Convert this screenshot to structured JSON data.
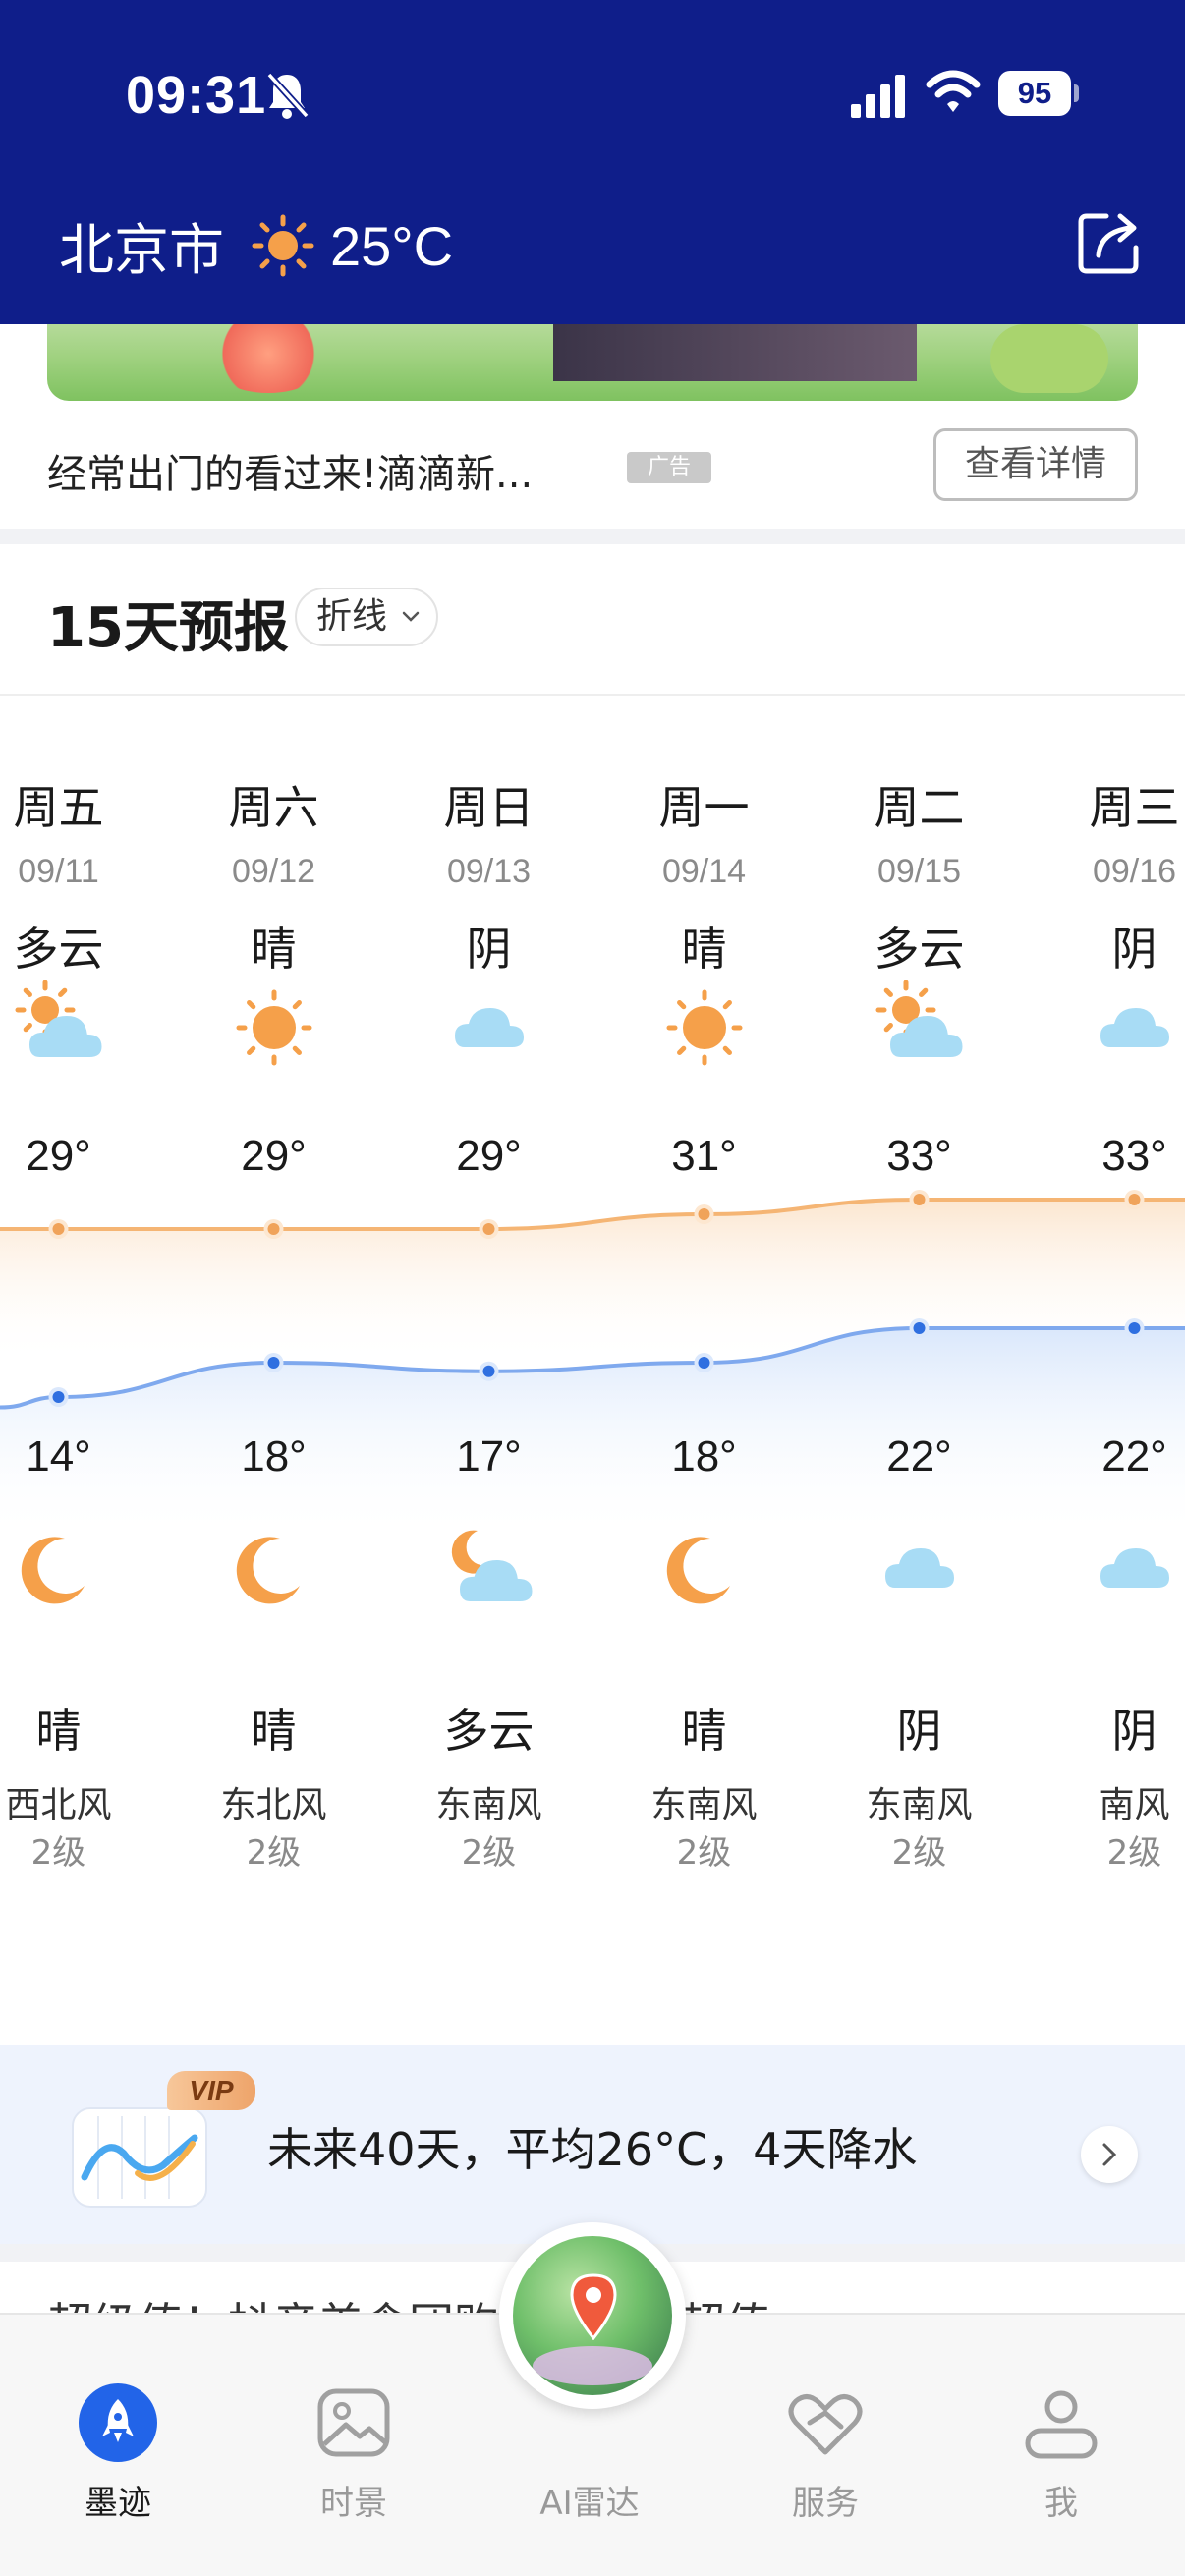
{
  "status_bar": {
    "time": "09:31",
    "battery": "95"
  },
  "header": {
    "city": "北京市",
    "temperature": "25°C"
  },
  "ad": {
    "text": "经常出门的看过来!滴滴新...",
    "badge": "广告",
    "detail_button": "查看详情"
  },
  "forecast": {
    "title": "15天预报",
    "toggle_label": "折线",
    "days": [
      {
        "name": "周五",
        "date": "09/11",
        "day_cond": "多云",
        "day_icon": "partly-cloudy-icon",
        "high": "29°",
        "low": "14°",
        "night_icon": "moon-icon",
        "night_cond": "晴",
        "wind_dir": "西北风",
        "wind_level": "2级"
      },
      {
        "name": "周六",
        "date": "09/12",
        "day_cond": "晴",
        "day_icon": "sun-icon",
        "high": "29°",
        "low": "18°",
        "night_icon": "moon-icon",
        "night_cond": "晴",
        "wind_dir": "东北风",
        "wind_level": "2级"
      },
      {
        "name": "周日",
        "date": "09/13",
        "day_cond": "阴",
        "day_icon": "cloud-icon",
        "high": "29°",
        "low": "17°",
        "night_icon": "moon-cloud-icon",
        "night_cond": "多云",
        "wind_dir": "东南风",
        "wind_level": "2级"
      },
      {
        "name": "周一",
        "date": "09/14",
        "day_cond": "晴",
        "day_icon": "sun-icon",
        "high": "31°",
        "low": "18°",
        "night_icon": "moon-icon",
        "night_cond": "晴",
        "wind_dir": "东南风",
        "wind_level": "2级"
      },
      {
        "name": "周二",
        "date": "09/15",
        "day_cond": "多云",
        "day_icon": "partly-cloudy-icon",
        "high": "33°",
        "low": "22°",
        "night_icon": "cloud-icon",
        "night_cond": "阴",
        "wind_dir": "东南风",
        "wind_level": "2级"
      },
      {
        "name": "周三",
        "date": "09/16",
        "day_cond": "阴",
        "day_icon": "cloud-icon",
        "high": "33°",
        "low": "22°",
        "night_icon": "cloud-icon",
        "night_cond": "阴",
        "wind_dir": "南风",
        "wind_level": "2级"
      }
    ]
  },
  "chart_data": {
    "type": "line",
    "x": [
      "09/11",
      "09/12",
      "09/13",
      "09/14",
      "09/15",
      "09/16"
    ],
    "series": [
      {
        "values": [
          29,
          29,
          29,
          31,
          33,
          33
        ]
      },
      {
        "values": [
          14,
          18,
          17,
          18,
          22,
          22
        ]
      }
    ],
    "colors": {
      "high": "#f5b574",
      "low": "#7fa9ee"
    }
  },
  "vip": {
    "badge": "VIP",
    "text": "未来40天，平均26°C，4天降水"
  },
  "peek": {
    "text": "超级值！抖音美食团购好物低价超值"
  },
  "tabs": [
    {
      "label": "墨迹",
      "icon": "rocket-icon",
      "active": true
    },
    {
      "label": "时景",
      "icon": "image-icon",
      "active": false
    },
    {
      "label": "AI雷达",
      "icon": "radar-icon",
      "active": false
    },
    {
      "label": "服务",
      "icon": "heart-hands-icon",
      "active": false
    },
    {
      "label": "我",
      "icon": "person-icon",
      "active": false
    }
  ],
  "colors": {
    "header_bg": "#0f1e8a",
    "sun": "#f5a04a",
    "cloud": "#a8dcf5",
    "active_tab": "#2264e8"
  }
}
